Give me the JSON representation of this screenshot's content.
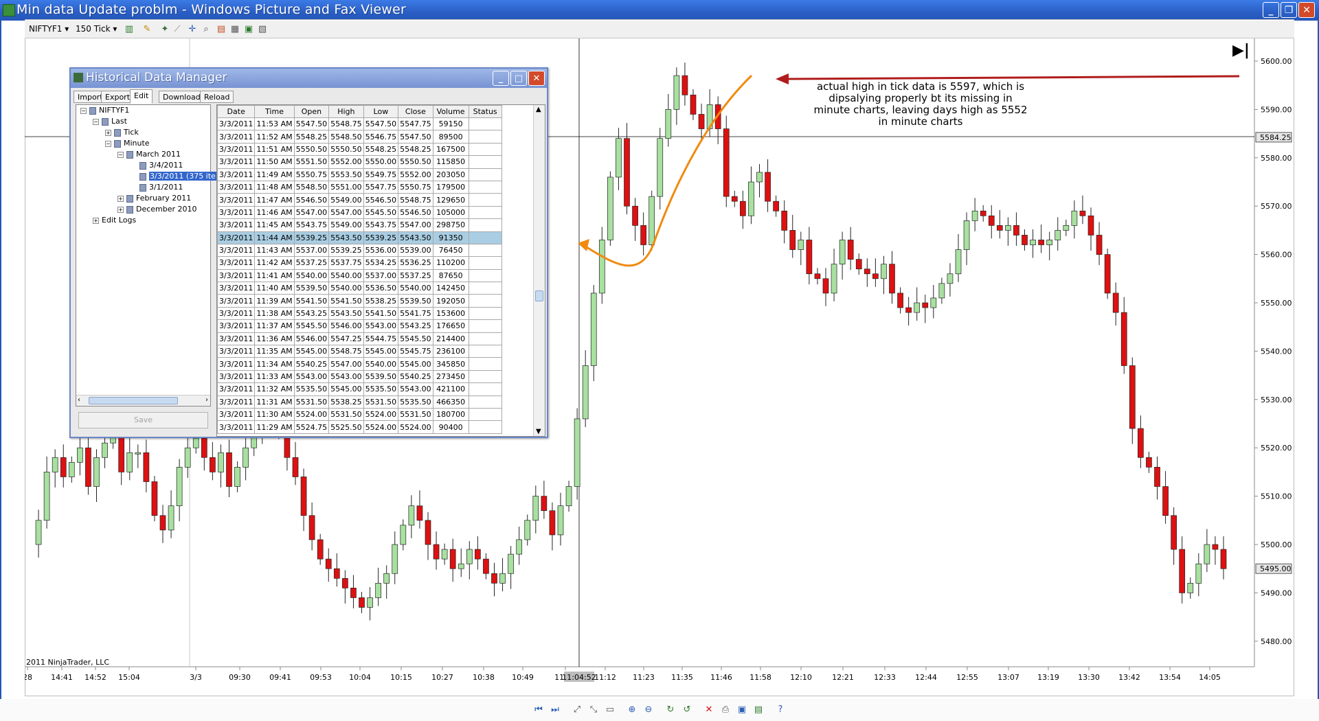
{
  "window": {
    "title": "Min data Update problm - Windows Picture and Fax Viewer",
    "minimize_label": "_",
    "restore_label": "❐",
    "close_label": "✕"
  },
  "toolbar": {
    "instrument": "NIFTYF1 ▾",
    "interval": "150 Tick ▾"
  },
  "annotation": {
    "text": "actual high in tick data is 5597, which is dipsalying properly bt its missing in minute charts, leaving days high as 5552 in minute charts"
  },
  "chart": {
    "copyright": "2011 NinjaTrader, LLC",
    "price_levels": [
      "5600.00",
      "5590.00",
      "5580.00",
      "5570.00",
      "5560.00",
      "5550.00",
      "5540.00",
      "5530.00",
      "5520.00",
      "5510.00",
      "5500.00",
      "5490.00",
      "5480.00"
    ],
    "current_price_top": "5584.25",
    "current_price_bottom": "5495.00",
    "time_labels": [
      "28",
      "14:41",
      "14:52",
      "15:04",
      "3/3",
      "09:30",
      "09:41",
      "09:53",
      "10:04",
      "10:15",
      "10:27",
      "10:38",
      "10:49",
      "11:00",
      "11:12",
      "11:23",
      "11:35",
      "11:46",
      "11:58",
      "12:10",
      "12:21",
      "12:33",
      "12:44",
      "12:55",
      "13:07",
      "13:19",
      "13:30",
      "13:42",
      "13:54",
      "14:05"
    ],
    "crosshair_time": "11:04:52",
    "end_icon": "▶|"
  },
  "dialog": {
    "title": "Historical Data Manager",
    "tabs": [
      "Import",
      "Export",
      "Edit",
      "Download",
      "Reload"
    ],
    "active_tab": "Edit",
    "save_label": "Save",
    "tree": {
      "root": "NIFTYF1",
      "last": "Last",
      "tick": "Tick",
      "minute": "Minute",
      "march": "March 2011",
      "d1": "3/4/2011",
      "d2": "3/3/2011 (375 ite",
      "d3": "3/1/2011",
      "feb": "February 2011",
      "dec": "December 2010",
      "logs": "Edit Logs"
    },
    "columns": [
      "Date",
      "Time",
      "Open",
      "High",
      "Low",
      "Close",
      "Volume",
      "Status"
    ],
    "highlight_row": 9,
    "rows": [
      [
        "3/3/2011",
        "11:53 AM",
        "5547.50",
        "5548.75",
        "5547.50",
        "5547.75",
        "59150",
        ""
      ],
      [
        "3/3/2011",
        "11:52 AM",
        "5548.25",
        "5548.50",
        "5546.75",
        "5547.50",
        "89500",
        ""
      ],
      [
        "3/3/2011",
        "11:51 AM",
        "5550.50",
        "5550.50",
        "5548.25",
        "5548.25",
        "167500",
        ""
      ],
      [
        "3/3/2011",
        "11:50 AM",
        "5551.50",
        "5552.00",
        "5550.00",
        "5550.50",
        "115850",
        ""
      ],
      [
        "3/3/2011",
        "11:49 AM",
        "5550.75",
        "5553.50",
        "5549.75",
        "5552.00",
        "203050",
        ""
      ],
      [
        "3/3/2011",
        "11:48 AM",
        "5548.50",
        "5551.00",
        "5547.75",
        "5550.75",
        "179500",
        ""
      ],
      [
        "3/3/2011",
        "11:47 AM",
        "5546.50",
        "5549.00",
        "5546.50",
        "5548.75",
        "129650",
        ""
      ],
      [
        "3/3/2011",
        "11:46 AM",
        "5547.00",
        "5547.00",
        "5545.50",
        "5546.50",
        "105000",
        ""
      ],
      [
        "3/3/2011",
        "11:45 AM",
        "5543.75",
        "5549.00",
        "5543.75",
        "5547.00",
        "298750",
        ""
      ],
      [
        "3/3/2011",
        "11:44 AM",
        "5539.25",
        "5543.50",
        "5539.25",
        "5543.50",
        "91350",
        ""
      ],
      [
        "3/3/2011",
        "11:43 AM",
        "5537.00",
        "5539.25",
        "5536.00",
        "5539.00",
        "76450",
        ""
      ],
      [
        "3/3/2011",
        "11:42 AM",
        "5537.25",
        "5537.75",
        "5534.25",
        "5536.25",
        "110200",
        ""
      ],
      [
        "3/3/2011",
        "11:41 AM",
        "5540.00",
        "5540.00",
        "5537.00",
        "5537.25",
        "87650",
        ""
      ],
      [
        "3/3/2011",
        "11:40 AM",
        "5539.50",
        "5540.00",
        "5536.50",
        "5540.00",
        "142450",
        ""
      ],
      [
        "3/3/2011",
        "11:39 AM",
        "5541.50",
        "5541.50",
        "5538.25",
        "5539.50",
        "192050",
        ""
      ],
      [
        "3/3/2011",
        "11:38 AM",
        "5543.25",
        "5543.50",
        "5541.50",
        "5541.75",
        "153600",
        ""
      ],
      [
        "3/3/2011",
        "11:37 AM",
        "5545.50",
        "5546.00",
        "5543.00",
        "5543.25",
        "176650",
        ""
      ],
      [
        "3/3/2011",
        "11:36 AM",
        "5546.00",
        "5547.25",
        "5544.75",
        "5545.50",
        "214400",
        ""
      ],
      [
        "3/3/2011",
        "11:35 AM",
        "5545.00",
        "5548.75",
        "5545.00",
        "5545.75",
        "236100",
        ""
      ],
      [
        "3/3/2011",
        "11:34 AM",
        "5540.25",
        "5547.00",
        "5540.00",
        "5545.00",
        "345850",
        ""
      ],
      [
        "3/3/2011",
        "11:33 AM",
        "5543.00",
        "5543.00",
        "5539.50",
        "5540.25",
        "273450",
        ""
      ],
      [
        "3/3/2011",
        "11:32 AM",
        "5535.50",
        "5545.00",
        "5535.50",
        "5543.00",
        "421100",
        ""
      ],
      [
        "3/3/2011",
        "11:31 AM",
        "5531.50",
        "5538.25",
        "5531.50",
        "5535.50",
        "466350",
        ""
      ],
      [
        "3/3/2011",
        "11:30 AM",
        "5524.00",
        "5531.50",
        "5524.00",
        "5531.50",
        "180700",
        ""
      ],
      [
        "3/3/2011",
        "11:29 AM",
        "5524.75",
        "5525.50",
        "5524.00",
        "5524.00",
        "90400",
        ""
      ]
    ]
  }
}
